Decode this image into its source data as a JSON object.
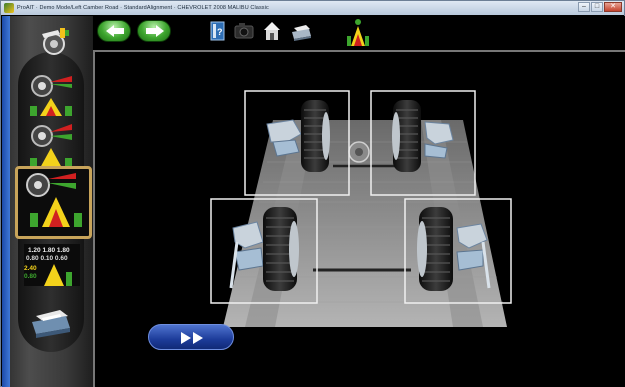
{
  "window": {
    "title": "ProAlT · Demo Mode/Left Camber Road · StandardAlignment · CHEVROLET 2008 MALIBU Classic",
    "minimize": "–",
    "maximize": "□",
    "close": "✕"
  },
  "sidebar": {
    "items": [
      {
        "name": "vehicle-select",
        "icon": "wrench-wheel-icon"
      },
      {
        "name": "caster-swing",
        "icon": "wheel-meter-icon"
      },
      {
        "name": "rear-measure",
        "icon": "wheel-meter-icon"
      },
      {
        "name": "front-measure",
        "icon": "wheel-meter-icon",
        "selected": true
      },
      {
        "name": "readings-summary",
        "icon": "readings-table-icon",
        "readings": [
          "1.20",
          "1.80",
          "1.80",
          "0.80",
          "0.10",
          "0.60",
          "2.40",
          "0.80"
        ]
      },
      {
        "name": "print",
        "icon": "printer-icon"
      }
    ]
  },
  "toolbar": {
    "back": "left-arrow-icon",
    "forward": "right-arrow-icon",
    "tools": [
      "help-book-icon",
      "camera-icon",
      "home-icon",
      "print-icon",
      "traffic-meter-icon"
    ]
  },
  "content": {
    "play": "play-forward-icon"
  },
  "colors": {
    "accent_green": "#3da52e",
    "selection_border": "#c8a45a",
    "play_blue": "#1d3c9a",
    "meter_red": "#d02020",
    "meter_yellow": "#f3d21b"
  }
}
